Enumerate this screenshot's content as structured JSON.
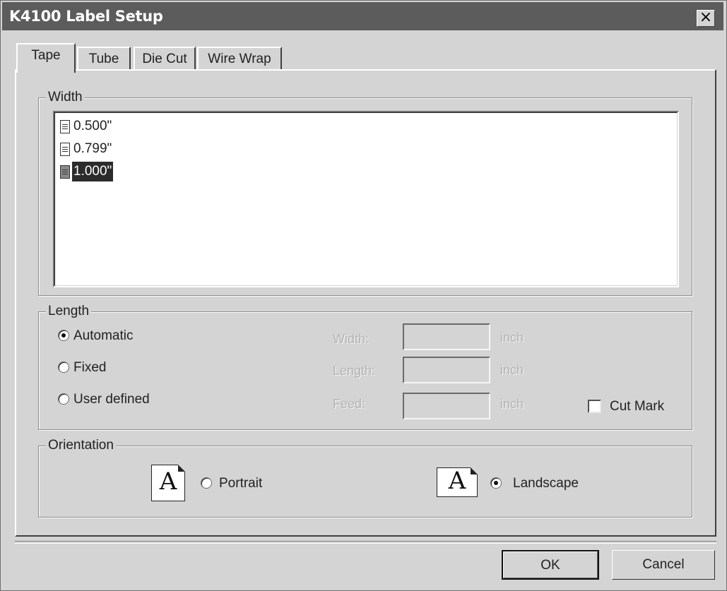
{
  "window": {
    "title": "K4100 Label Setup",
    "close_glyph": "×"
  },
  "tabs": [
    {
      "label": "Tape",
      "active": true
    },
    {
      "label": "Tube"
    },
    {
      "label": "Die Cut"
    },
    {
      "label": "Wire Wrap"
    }
  ],
  "width_group": {
    "legend": "Width",
    "items": [
      {
        "label": "0.500\"",
        "icon": "document-icon"
      },
      {
        "label": "0.799\"",
        "icon": "document-icon"
      },
      {
        "label": "1.000\"",
        "icon": "document-icon",
        "selected": true
      }
    ]
  },
  "length_group": {
    "legend": "Length",
    "options": [
      {
        "label": "Automatic",
        "checked": true
      },
      {
        "label": "Fixed",
        "checked": false
      },
      {
        "label": "User defined",
        "checked": false
      }
    ],
    "fields": [
      {
        "label": "Width:",
        "value": "",
        "unit": "inch"
      },
      {
        "label": "Length:",
        "value": "",
        "unit": "inch"
      },
      {
        "label": "Feed:",
        "value": "",
        "unit": "inch"
      }
    ],
    "cut_mark": {
      "label": "Cut Mark",
      "checked": false
    }
  },
  "orientation_group": {
    "legend": "Orientation",
    "options": [
      {
        "label": "Portrait",
        "checked": false,
        "icon_letter": "A"
      },
      {
        "label": "Landscape",
        "checked": true,
        "icon_letter": "A"
      }
    ]
  },
  "buttons": {
    "ok": "OK",
    "cancel": "Cancel"
  },
  "colors": {
    "titlebar": "#5c5c5c",
    "face": "#d4d4d4",
    "selection": "#2b2b2b"
  }
}
